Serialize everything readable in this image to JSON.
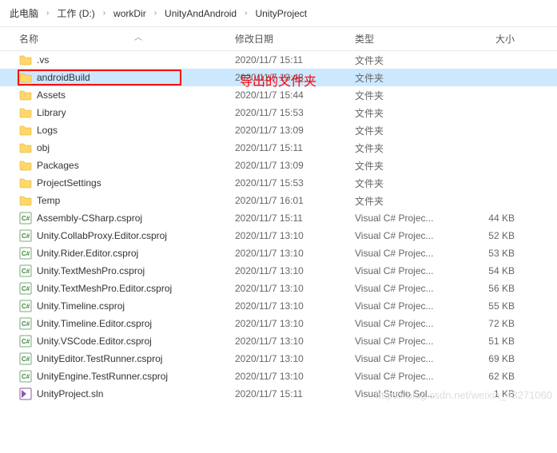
{
  "breadcrumb": [
    "此电脑",
    "工作 (D:)",
    "workDir",
    "UnityAndAndroid",
    "UnityProject"
  ],
  "columns": {
    "name": "名称",
    "date": "修改日期",
    "type": "类型",
    "size": "大小"
  },
  "folder_type": "文件夹",
  "csproj_type": "Visual C# Projec...",
  "sln_type": "Visual Studio Sol...",
  "annotation": "导出的文件夹",
  "watermark": "https://blog.csdn.net/weixin_43271060",
  "rows": [
    {
      "icon": "folder",
      "name": ".vs",
      "date": "2020/11/7 15:11",
      "type_key": "folder_type",
      "size": ""
    },
    {
      "icon": "folder",
      "name": "androidBuild",
      "date": "2020/11/7 13:43",
      "type_key": "folder_type",
      "size": "",
      "selected": true,
      "highlight": true
    },
    {
      "icon": "folder",
      "name": "Assets",
      "date": "2020/11/7 15:44",
      "type_key": "folder_type",
      "size": ""
    },
    {
      "icon": "folder",
      "name": "Library",
      "date": "2020/11/7 15:53",
      "type_key": "folder_type",
      "size": ""
    },
    {
      "icon": "folder",
      "name": "Logs",
      "date": "2020/11/7 13:09",
      "type_key": "folder_type",
      "size": ""
    },
    {
      "icon": "folder",
      "name": "obj",
      "date": "2020/11/7 15:11",
      "type_key": "folder_type",
      "size": ""
    },
    {
      "icon": "folder",
      "name": "Packages",
      "date": "2020/11/7 13:09",
      "type_key": "folder_type",
      "size": ""
    },
    {
      "icon": "folder",
      "name": "ProjectSettings",
      "date": "2020/11/7 15:53",
      "type_key": "folder_type",
      "size": ""
    },
    {
      "icon": "folder",
      "name": "Temp",
      "date": "2020/11/7 16:01",
      "type_key": "folder_type",
      "size": ""
    },
    {
      "icon": "csproj",
      "name": "Assembly-CSharp.csproj",
      "date": "2020/11/7 15:11",
      "type_key": "csproj_type",
      "size": "44 KB"
    },
    {
      "icon": "csproj",
      "name": "Unity.CollabProxy.Editor.csproj",
      "date": "2020/11/7 13:10",
      "type_key": "csproj_type",
      "size": "52 KB"
    },
    {
      "icon": "csproj",
      "name": "Unity.Rider.Editor.csproj",
      "date": "2020/11/7 13:10",
      "type_key": "csproj_type",
      "size": "53 KB"
    },
    {
      "icon": "csproj",
      "name": "Unity.TextMeshPro.csproj",
      "date": "2020/11/7 13:10",
      "type_key": "csproj_type",
      "size": "54 KB"
    },
    {
      "icon": "csproj",
      "name": "Unity.TextMeshPro.Editor.csproj",
      "date": "2020/11/7 13:10",
      "type_key": "csproj_type",
      "size": "56 KB"
    },
    {
      "icon": "csproj",
      "name": "Unity.Timeline.csproj",
      "date": "2020/11/7 13:10",
      "type_key": "csproj_type",
      "size": "55 KB"
    },
    {
      "icon": "csproj",
      "name": "Unity.Timeline.Editor.csproj",
      "date": "2020/11/7 13:10",
      "type_key": "csproj_type",
      "size": "72 KB"
    },
    {
      "icon": "csproj",
      "name": "Unity.VSCode.Editor.csproj",
      "date": "2020/11/7 13:10",
      "type_key": "csproj_type",
      "size": "51 KB"
    },
    {
      "icon": "csproj",
      "name": "UnityEditor.TestRunner.csproj",
      "date": "2020/11/7 13:10",
      "type_key": "csproj_type",
      "size": "69 KB"
    },
    {
      "icon": "csproj",
      "name": "UnityEngine.TestRunner.csproj",
      "date": "2020/11/7 13:10",
      "type_key": "csproj_type",
      "size": "62 KB"
    },
    {
      "icon": "sln",
      "name": "UnityProject.sln",
      "date": "2020/11/7 15:11",
      "type_key": "sln_type",
      "size": "1 KB"
    }
  ]
}
